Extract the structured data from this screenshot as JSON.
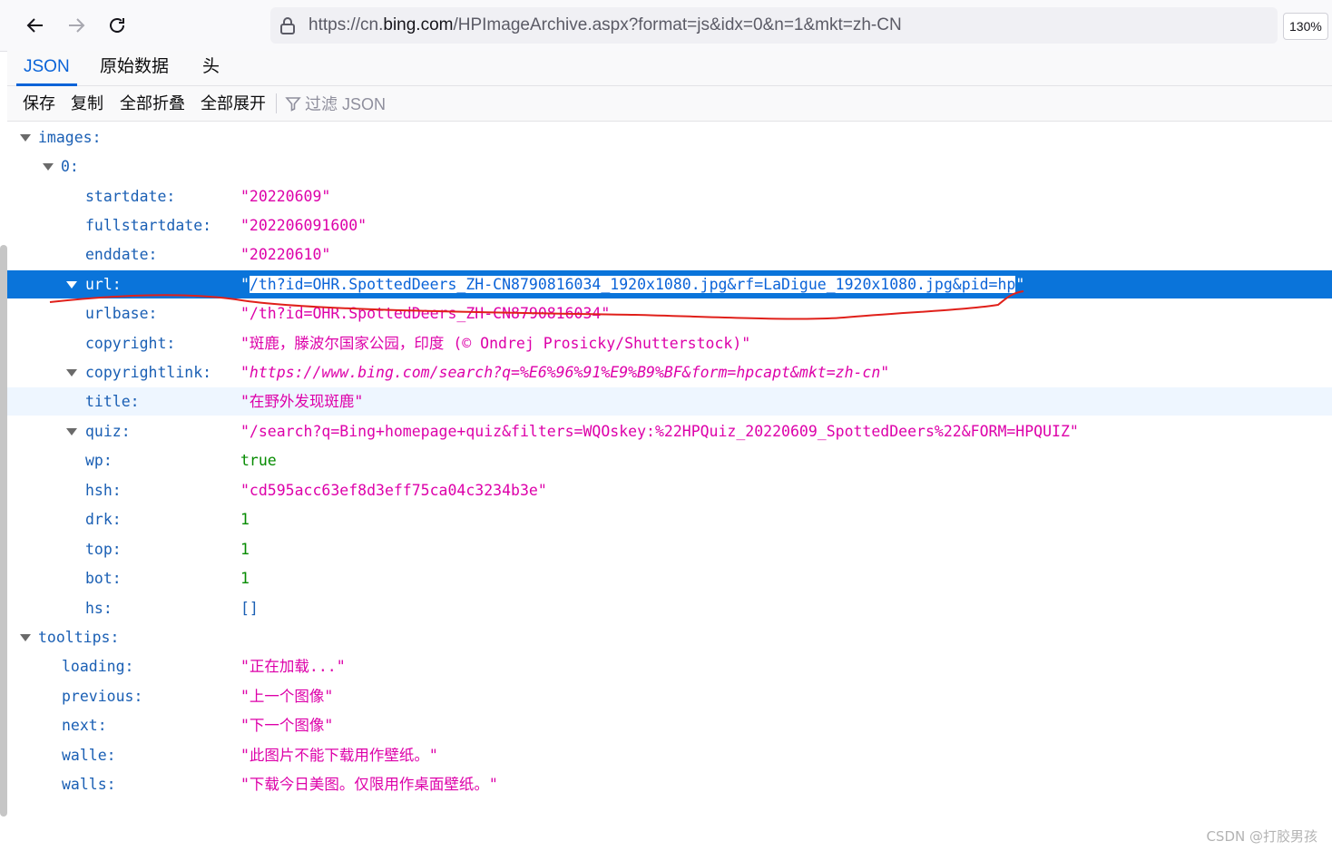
{
  "browser": {
    "url_prefix": "https://cn.",
    "url_host": "bing.com",
    "url_path": "/HPImageArchive.aspx?format=js&idx=0&n=1&mkt=zh-CN",
    "zoom": "130%"
  },
  "viewer": {
    "tabs": [
      "JSON",
      "原始数据",
      "头"
    ],
    "toolbar": {
      "save": "保存",
      "copy": "复制",
      "collapse_all": "全部折叠",
      "expand_all": "全部展开",
      "filter_placeholder": "过滤 JSON"
    }
  },
  "json_tree": {
    "images_key": "images:",
    "item_key": "0:",
    "fields": {
      "startdate": {
        "key": "startdate:",
        "value": "\"20220609\""
      },
      "fullstartdate": {
        "key": "fullstartdate:",
        "value": "\"202206091600\""
      },
      "enddate": {
        "key": "enddate:",
        "value": "\"20220610\""
      },
      "url": {
        "key": "url:",
        "value_open": "\"",
        "value": "/th?id=OHR.SpottedDeers_ZH-CN8790816034_1920x1080.jpg&rf=LaDigue_1920x1080.jpg&pid=hp",
        "value_close": "\""
      },
      "urlbase": {
        "key": "urlbase:",
        "value": "\"/th?id=OHR.SpottedDeers_ZH-CN8790816034\""
      },
      "copyright": {
        "key": "copyright:",
        "value": "\"斑鹿，滕波尔国家公园，印度 (© Ondrej Prosicky/Shutterstock)\""
      },
      "copyrightlink": {
        "key": "copyrightlink:",
        "value": "\"https://www.bing.com/search?q=%E6%96%91%E9%B9%BF&form=hpcapt&mkt=zh-cn\""
      },
      "title": {
        "key": "title:",
        "value": "\"在野外发现斑鹿\""
      },
      "quiz": {
        "key": "quiz:",
        "value": "\"/search?q=Bing+homepage+quiz&filters=WQOskey:%22HPQuiz_20220609_SpottedDeers%22&FORM=HPQUIZ\""
      },
      "wp": {
        "key": "wp:",
        "value": "true"
      },
      "hsh": {
        "key": "hsh:",
        "value": "\"cd595acc63ef8d3eff75ca04c3234b3e\""
      },
      "drk": {
        "key": "drk:",
        "value": "1"
      },
      "top": {
        "key": "top:",
        "value": "1"
      },
      "bot": {
        "key": "bot:",
        "value": "1"
      },
      "hs": {
        "key": "hs:",
        "value": "[]"
      }
    },
    "tooltips_key": "tooltips:",
    "tooltips": {
      "loading": {
        "key": "loading:",
        "value": "\"正在加载...\""
      },
      "previous": {
        "key": "previous:",
        "value": "\"上一个图像\""
      },
      "next": {
        "key": "next:",
        "value": "\"下一个图像\""
      },
      "walle": {
        "key": "walle:",
        "value": "\"此图片不能下载用作壁纸。\""
      },
      "walls": {
        "key": "walls:",
        "value": "\"下载今日美图。仅限用作桌面壁纸。\""
      }
    }
  },
  "watermark": "CSDN @打胶男孩",
  "colors": {
    "selection": "#0a74da",
    "key": "#1a5fb4",
    "string": "#dd00a9",
    "number": "#058b00",
    "annotation_stroke": "#e0201a"
  }
}
